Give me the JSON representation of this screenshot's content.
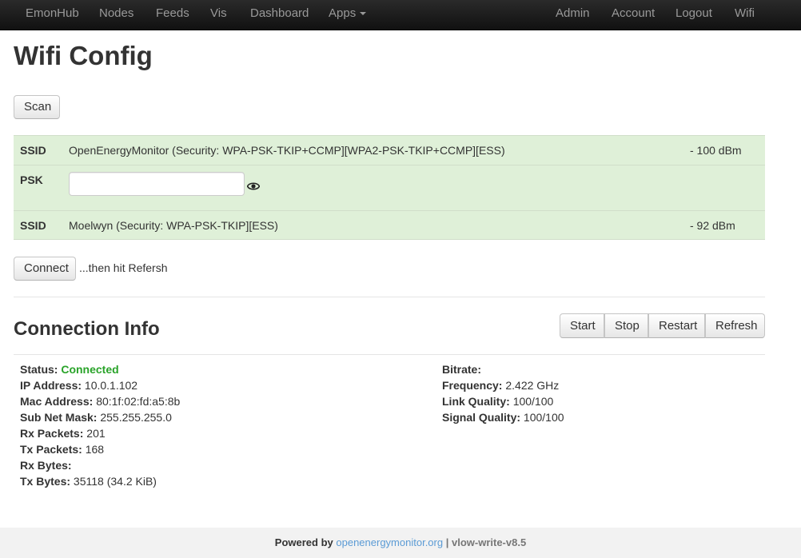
{
  "nav": {
    "left": [
      "EmonHub",
      "Nodes",
      "Feeds",
      "Vis",
      "Dashboard",
      "Apps"
    ],
    "right": [
      "Admin",
      "Account",
      "Logout",
      "Wifi"
    ]
  },
  "page_title": "Wifi Config",
  "scan_label": "Scan",
  "networks": [
    {
      "label": "SSID",
      "desc": "OpenEnergyMonitor (Security: WPA-PSK-TKIP+CCMP][WPA2-PSK-TKIP+CCMP][ESS)",
      "signal": "- 100 dBm"
    },
    {
      "label": "PSK",
      "value": "",
      "icon": "eye-icon"
    },
    {
      "label": "SSID",
      "desc": "Moelwyn (Security: WPA-PSK-TKIP][ESS)",
      "signal": "- 92 dBm"
    }
  ],
  "connect_label": "Connect",
  "connect_hint": "...then hit Refersh",
  "connection_title": "Connection Info",
  "actions": [
    "Start",
    "Stop",
    "Restart",
    "Refresh"
  ],
  "info_left": [
    {
      "label": "Status:",
      "value": "Connected"
    },
    {
      "label": "IP Address:",
      "value": "10.0.1.102"
    },
    {
      "label": "Mac Address:",
      "value": "80:1f:02:fd:a5:8b"
    },
    {
      "label": "Sub Net Mask:",
      "value": "255.255.255.0"
    },
    {
      "label": "Rx Packets:",
      "value": "201"
    },
    {
      "label": "Tx Packets:",
      "value": "168"
    },
    {
      "label": "Rx Bytes:",
      "value": ""
    },
    {
      "label": "Tx Bytes:",
      "value": "35118 (34.2 KiB)"
    }
  ],
  "info_right": [
    {
      "label": "Bitrate:",
      "value": ""
    },
    {
      "label": "Frequency:",
      "value": "2.422 GHz"
    },
    {
      "label": "Link Quality:",
      "value": "100/100"
    },
    {
      "label": "Signal Quality:",
      "value": "100/100"
    }
  ],
  "footer": {
    "powered_by": "Powered by",
    "link": "openenergymonitor.org",
    "separator": "|",
    "version": "vlow-write-v8.5"
  },
  "colors": {
    "connected": "#29a329",
    "network_row": "#dff0d8",
    "link": "#5b9bd5"
  }
}
